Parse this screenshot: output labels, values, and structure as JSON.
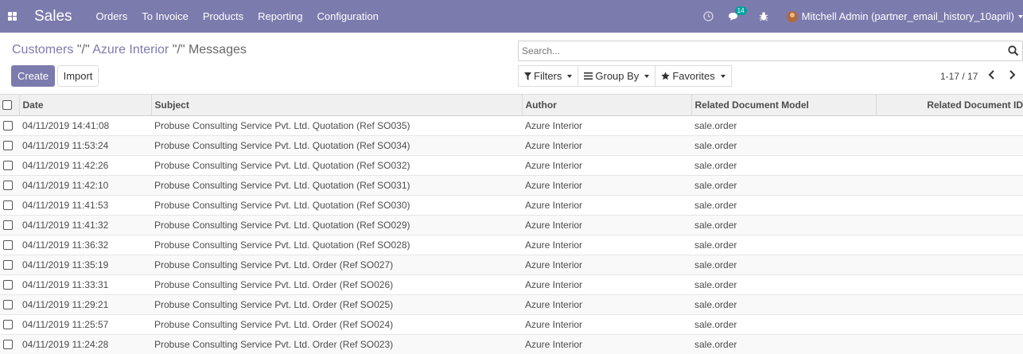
{
  "navbar": {
    "app_name": "Sales",
    "menu": [
      "Orders",
      "To Invoice",
      "Products",
      "Reporting",
      "Configuration"
    ],
    "message_count": "14",
    "user": "Mitchell Admin (partner_email_history_10april)",
    "color": "#7c7bad"
  },
  "breadcrumb": {
    "items": [
      "Customers",
      "Azure Interior",
      "Messages"
    ],
    "separator": "\"/\""
  },
  "buttons": {
    "create": "Create",
    "import": "Import"
  },
  "search": {
    "placeholder": "Search..."
  },
  "filters": {
    "filters": "Filters",
    "group_by": "Group By",
    "favorites": "Favorites"
  },
  "pager": {
    "text": "1-17 / 17"
  },
  "table": {
    "columns": [
      "Date",
      "Subject",
      "Author",
      "Related Document Model",
      "Related Document ID"
    ],
    "rows": [
      [
        "04/11/2019 14:41:08",
        "Probuse Consulting Service Pvt. Ltd. Quotation (Ref SO035)",
        "Azure Interior",
        "sale.order"
      ],
      [
        "04/11/2019 11:53:24",
        "Probuse Consulting Service Pvt. Ltd. Quotation (Ref SO034)",
        "Azure Interior",
        "sale.order"
      ],
      [
        "04/11/2019 11:42:26",
        "Probuse Consulting Service Pvt. Ltd. Quotation (Ref SO032)",
        "Azure Interior",
        "sale.order"
      ],
      [
        "04/11/2019 11:42:10",
        "Probuse Consulting Service Pvt. Ltd. Quotation (Ref SO031)",
        "Azure Interior",
        "sale.order"
      ],
      [
        "04/11/2019 11:41:53",
        "Probuse Consulting Service Pvt. Ltd. Quotation (Ref SO030)",
        "Azure Interior",
        "sale.order"
      ],
      [
        "04/11/2019 11:41:32",
        "Probuse Consulting Service Pvt. Ltd. Quotation (Ref SO029)",
        "Azure Interior",
        "sale.order"
      ],
      [
        "04/11/2019 11:36:32",
        "Probuse Consulting Service Pvt. Ltd. Quotation (Ref SO028)",
        "Azure Interior",
        "sale.order"
      ],
      [
        "04/11/2019 11:35:19",
        "Probuse Consulting Service Pvt. Ltd. Order (Ref SO027)",
        "Azure Interior",
        "sale.order"
      ],
      [
        "04/11/2019 11:33:31",
        "Probuse Consulting Service Pvt. Ltd. Order (Ref SO026)",
        "Azure Interior",
        "sale.order"
      ],
      [
        "04/11/2019 11:29:21",
        "Probuse Consulting Service Pvt. Ltd. Order (Ref SO025)",
        "Azure Interior",
        "sale.order"
      ],
      [
        "04/11/2019 11:25:57",
        "Probuse Consulting Service Pvt. Ltd. Order (Ref SO024)",
        "Azure Interior",
        "sale.order"
      ],
      [
        "04/11/2019 11:24:28",
        "Probuse Consulting Service Pvt. Ltd. Order (Ref SO023)",
        "Azure Interior",
        "sale.order"
      ]
    ]
  }
}
